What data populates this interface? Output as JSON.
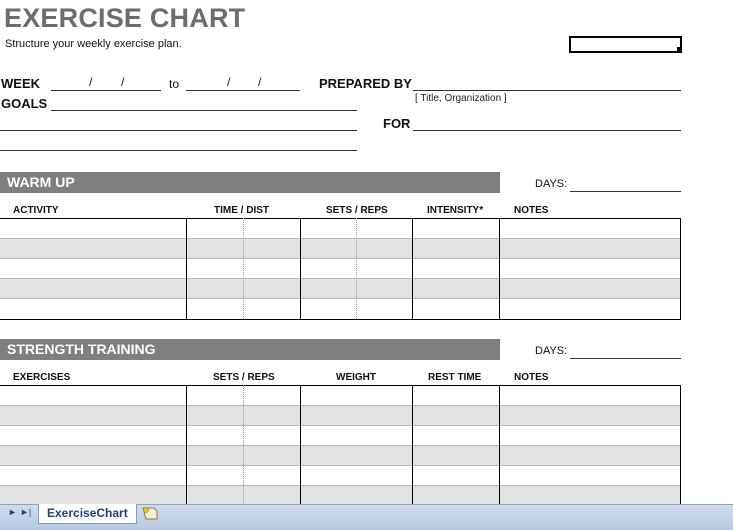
{
  "header": {
    "title": "EXERCISE CHART",
    "subtitle": "Structure your weekly exercise plan."
  },
  "form": {
    "week_label": "WEEK",
    "date_sep": "/",
    "to_label": "to",
    "goals_label": "GOALS",
    "prepared_by_label": "PREPARED BY",
    "prepared_by_hint": "[ Title, Organization ]",
    "for_label": "FOR"
  },
  "warm_up": {
    "title": "WARM UP",
    "days_label": "DAYS:",
    "columns": [
      "ACTIVITY",
      "TIME / DIST",
      "SETS / REPS",
      "INTENSITY*",
      "NOTES"
    ]
  },
  "strength": {
    "title": "STRENGTH TRAINING",
    "days_label": "DAYS:",
    "columns": [
      "EXERCISES",
      "SETS / REPS",
      "WEIGHT",
      "REST TIME",
      "NOTES"
    ]
  },
  "sheet_tabs": {
    "nav_next": "►",
    "nav_last": "►|",
    "active_tab": "ExerciseChart"
  },
  "colors": {
    "section_band": "#7f7f7f",
    "row_shade": "#e3e3e3",
    "title_gray": "#6d6d6d",
    "tab_text": "#1f3d7a"
  },
  "icons": {
    "new_sheet": "insert-sheet-icon"
  }
}
